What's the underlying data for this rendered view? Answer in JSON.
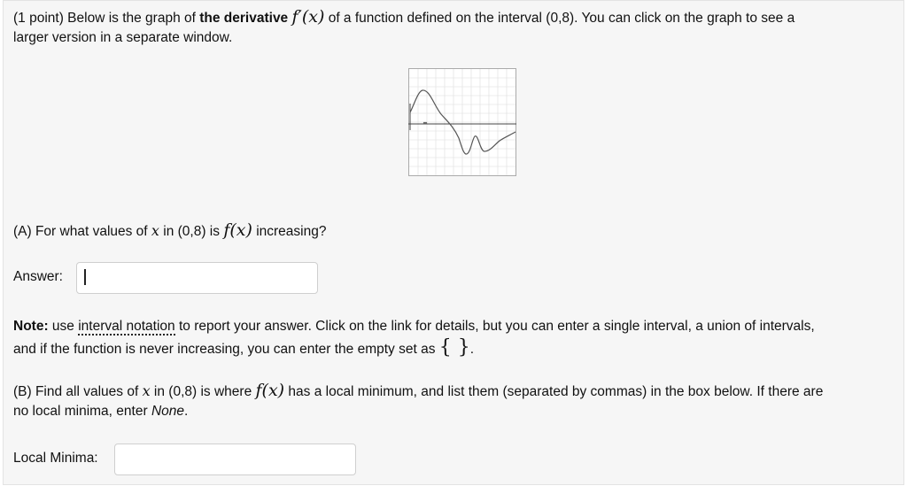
{
  "problem": {
    "points": "(1 point)",
    "intro_1": " Below is the graph of ",
    "derivative_bold": "the derivative",
    "fprime_x": "f′(x)",
    "intro_2": " of a function defined on the interval (0,8). You can click on the graph to see a",
    "intro_line2": "larger version in a separate window."
  },
  "graph": {
    "curve_color": "#555555",
    "grid_color": "#dddddd"
  },
  "part_a": {
    "q_1": "(A) For what values of ",
    "x": "x",
    "q_2": " in (0,8) is ",
    "fx": "f(x)",
    "q_3": " increasing?",
    "answer_label": "Answer:",
    "answer_value": ""
  },
  "note": {
    "bold": "Note:",
    "t1": " use ",
    "link": "interval notation",
    "t2": " to report your answer. Click on the link for details, but you can enter a single interval, a union of intervals,",
    "line2": "and if the function is never increasing, you can enter the empty set as ",
    "empty_set": "{ }",
    "period": "."
  },
  "part_b": {
    "q_1": "(B) Find all values of ",
    "x": "x",
    "q_2": " in (0,8) is where ",
    "fx": "f(x)",
    "q_3": " has a local minimum, and list them (separated by commas) in the box below. If there are",
    "line2_pre": "no local minima, enter ",
    "none_word": "None",
    "line2_post": ".",
    "label": "Local Minima:",
    "value": ""
  }
}
